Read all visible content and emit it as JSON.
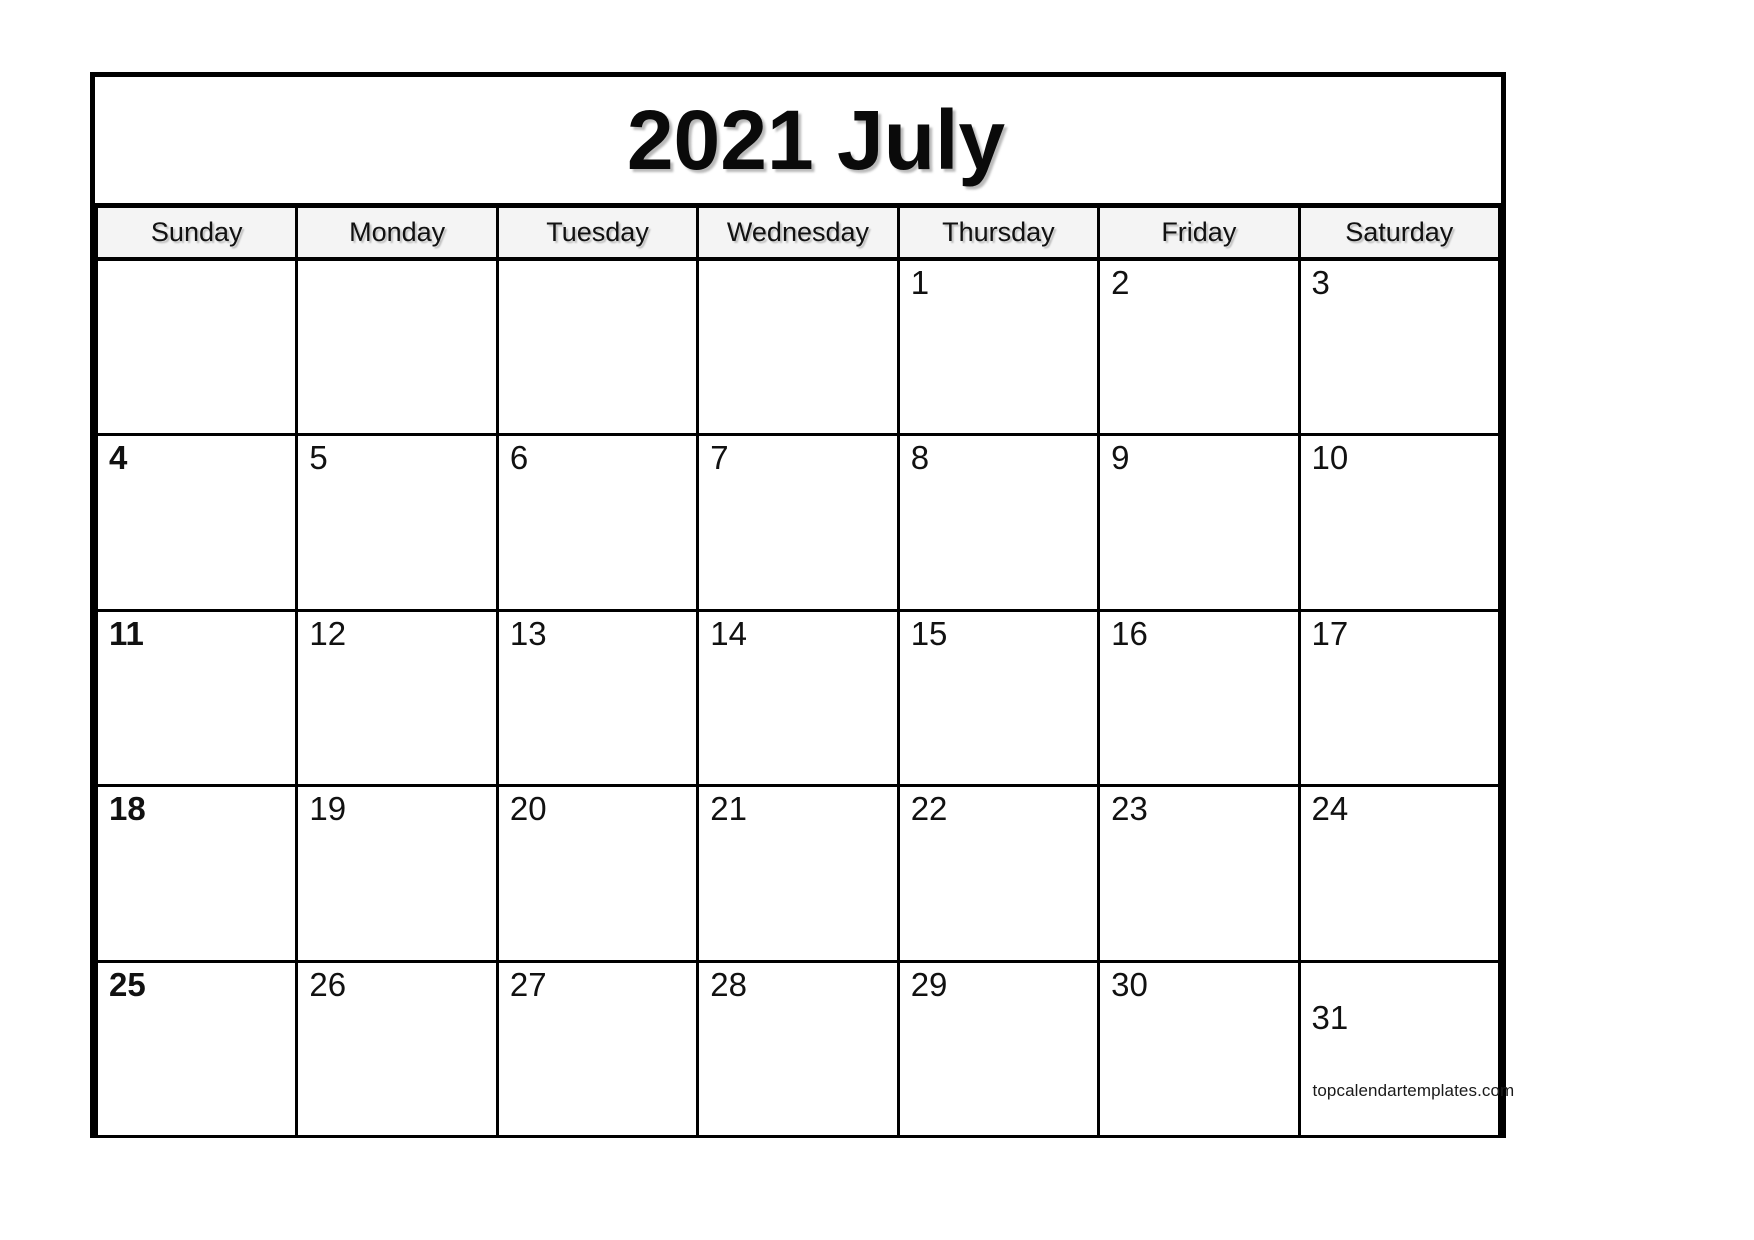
{
  "calendar": {
    "title": "2021 July",
    "year": "2021",
    "month": "July",
    "weekday_headers": [
      "Sunday",
      "Monday",
      "Tuesday",
      "Wednesday",
      "Thursday",
      "Friday",
      "Saturday"
    ],
    "weeks": [
      {
        "shaded": false,
        "days": [
          {
            "label": "",
            "bold": false,
            "empty": true
          },
          {
            "label": "",
            "bold": false,
            "empty": true
          },
          {
            "label": "",
            "bold": false,
            "empty": true
          },
          {
            "label": "",
            "bold": false,
            "empty": true
          },
          {
            "label": "1",
            "bold": false,
            "empty": false
          },
          {
            "label": "2",
            "bold": false,
            "empty": false
          },
          {
            "label": "3",
            "bold": false,
            "empty": false
          }
        ]
      },
      {
        "shaded": true,
        "days": [
          {
            "label": "4",
            "bold": true,
            "empty": false
          },
          {
            "label": "5",
            "bold": false,
            "empty": false
          },
          {
            "label": "6",
            "bold": false,
            "empty": false
          },
          {
            "label": "7",
            "bold": false,
            "empty": false
          },
          {
            "label": "8",
            "bold": false,
            "empty": false
          },
          {
            "label": "9",
            "bold": false,
            "empty": false
          },
          {
            "label": "10",
            "bold": false,
            "empty": false
          }
        ]
      },
      {
        "shaded": false,
        "days": [
          {
            "label": "11",
            "bold": true,
            "empty": false
          },
          {
            "label": "12",
            "bold": false,
            "empty": false
          },
          {
            "label": "13",
            "bold": false,
            "empty": false
          },
          {
            "label": "14",
            "bold": false,
            "empty": false
          },
          {
            "label": "15",
            "bold": false,
            "empty": false
          },
          {
            "label": "16",
            "bold": false,
            "empty": false
          },
          {
            "label": "17",
            "bold": false,
            "empty": false
          }
        ]
      },
      {
        "shaded": true,
        "days": [
          {
            "label": "18",
            "bold": true,
            "empty": false
          },
          {
            "label": "19",
            "bold": false,
            "empty": false
          },
          {
            "label": "20",
            "bold": false,
            "empty": false
          },
          {
            "label": "21",
            "bold": false,
            "empty": false
          },
          {
            "label": "22",
            "bold": false,
            "empty": false
          },
          {
            "label": "23",
            "bold": false,
            "empty": false
          },
          {
            "label": "24",
            "bold": false,
            "empty": false
          }
        ]
      },
      {
        "shaded": false,
        "days": [
          {
            "label": "25",
            "bold": true,
            "empty": false
          },
          {
            "label": "26",
            "bold": false,
            "empty": false
          },
          {
            "label": "27",
            "bold": false,
            "empty": false
          },
          {
            "label": "28",
            "bold": false,
            "empty": false
          },
          {
            "label": "29",
            "bold": false,
            "empty": false
          },
          {
            "label": "30",
            "bold": false,
            "empty": false
          },
          {
            "label": "31",
            "bold": false,
            "empty": false,
            "lowered": true
          }
        ]
      }
    ],
    "watermark": "topcalendartemplates.com",
    "colors": {
      "border": "#000000",
      "shaded_row_background": "#f4f4f4",
      "header_background": "#f4f4f4",
      "page_background": "#ffffff",
      "text": "#111111"
    }
  }
}
